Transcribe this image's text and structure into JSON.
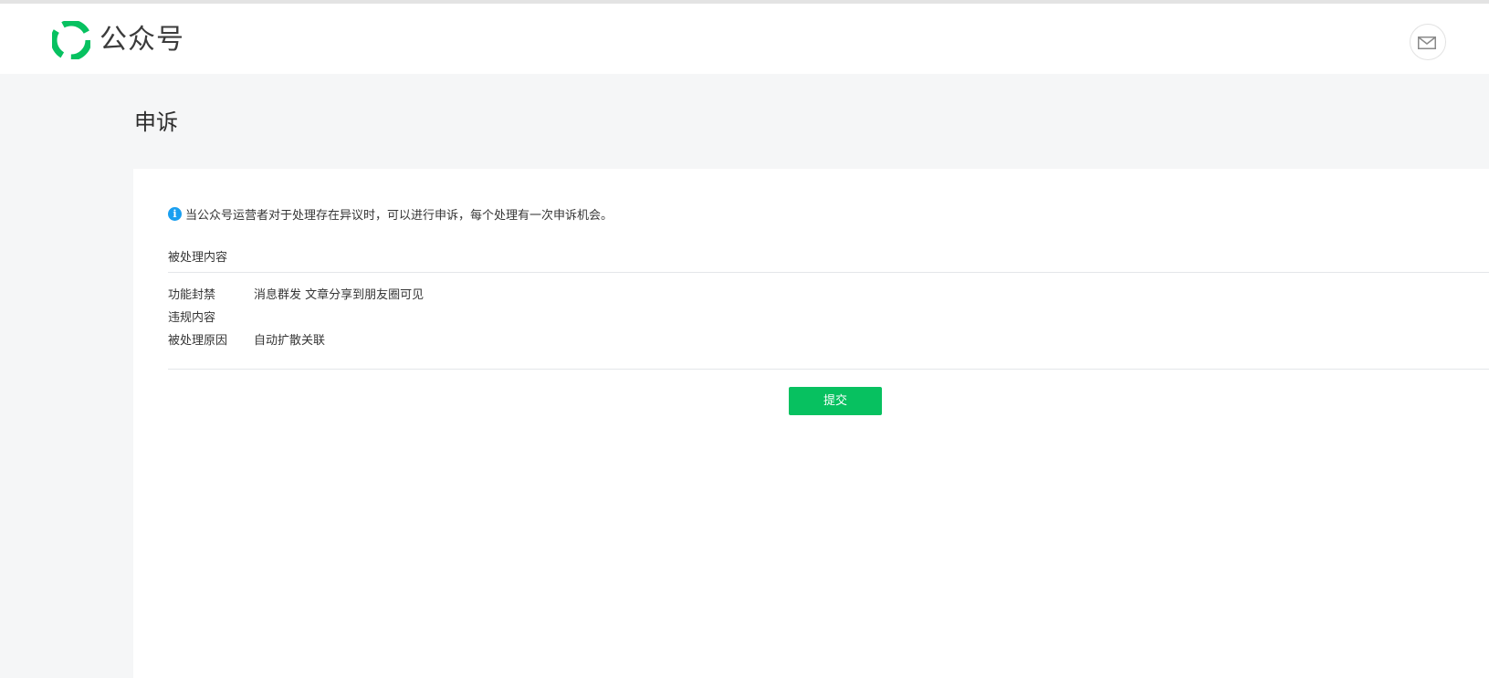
{
  "header": {
    "logo_text": "公众号",
    "brand_color": "#07c160",
    "message_icon": "mail-icon"
  },
  "page": {
    "title": "申诉"
  },
  "notice": {
    "icon": "info-icon",
    "icon_glyph": "i",
    "text": "当公众号运营者对于处理存在异议时，可以进行申诉，每个处理有一次申诉机会。"
  },
  "section": {
    "title": "被处理内容"
  },
  "details": [
    {
      "label": "功能封禁",
      "value": "消息群发 文章分享到朋友圈可见"
    },
    {
      "label": "违规内容",
      "value": ""
    },
    {
      "label": "被处理原因",
      "value": "自动扩散关联"
    }
  ],
  "actions": {
    "submit_label": "提交",
    "submit_color": "#07c160"
  }
}
